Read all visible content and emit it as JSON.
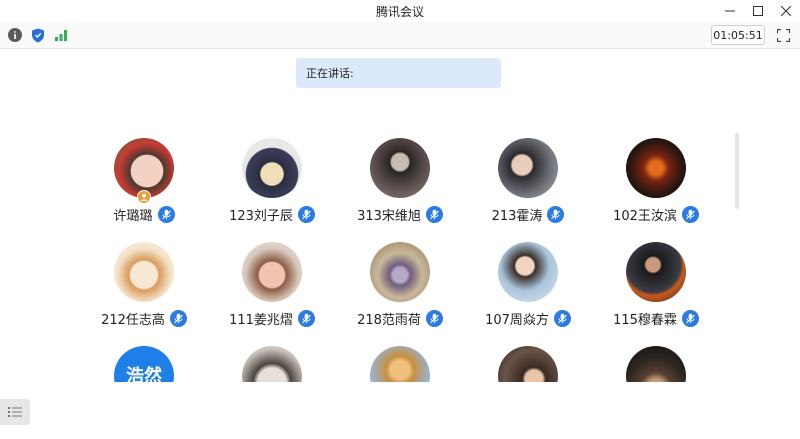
{
  "window": {
    "title": "腾讯会议"
  },
  "toolbar": {
    "timer": "01:05:51"
  },
  "speaking": {
    "label": "正在讲话:"
  },
  "participants": [
    {
      "name": "许璐璐",
      "host": true
    },
    {
      "name": "123刘子辰"
    },
    {
      "name": "313宋维旭"
    },
    {
      "name": "213霍涛"
    },
    {
      "name": "102王汝滨"
    },
    {
      "name": "212任志高"
    },
    {
      "name": "111姜兆熠"
    },
    {
      "name": "218范雨荷"
    },
    {
      "name": "107周焱方"
    },
    {
      "name": "115穆春霖"
    },
    {
      "avatar_text": "浩然"
    },
    {},
    {},
    {},
    {}
  ]
}
